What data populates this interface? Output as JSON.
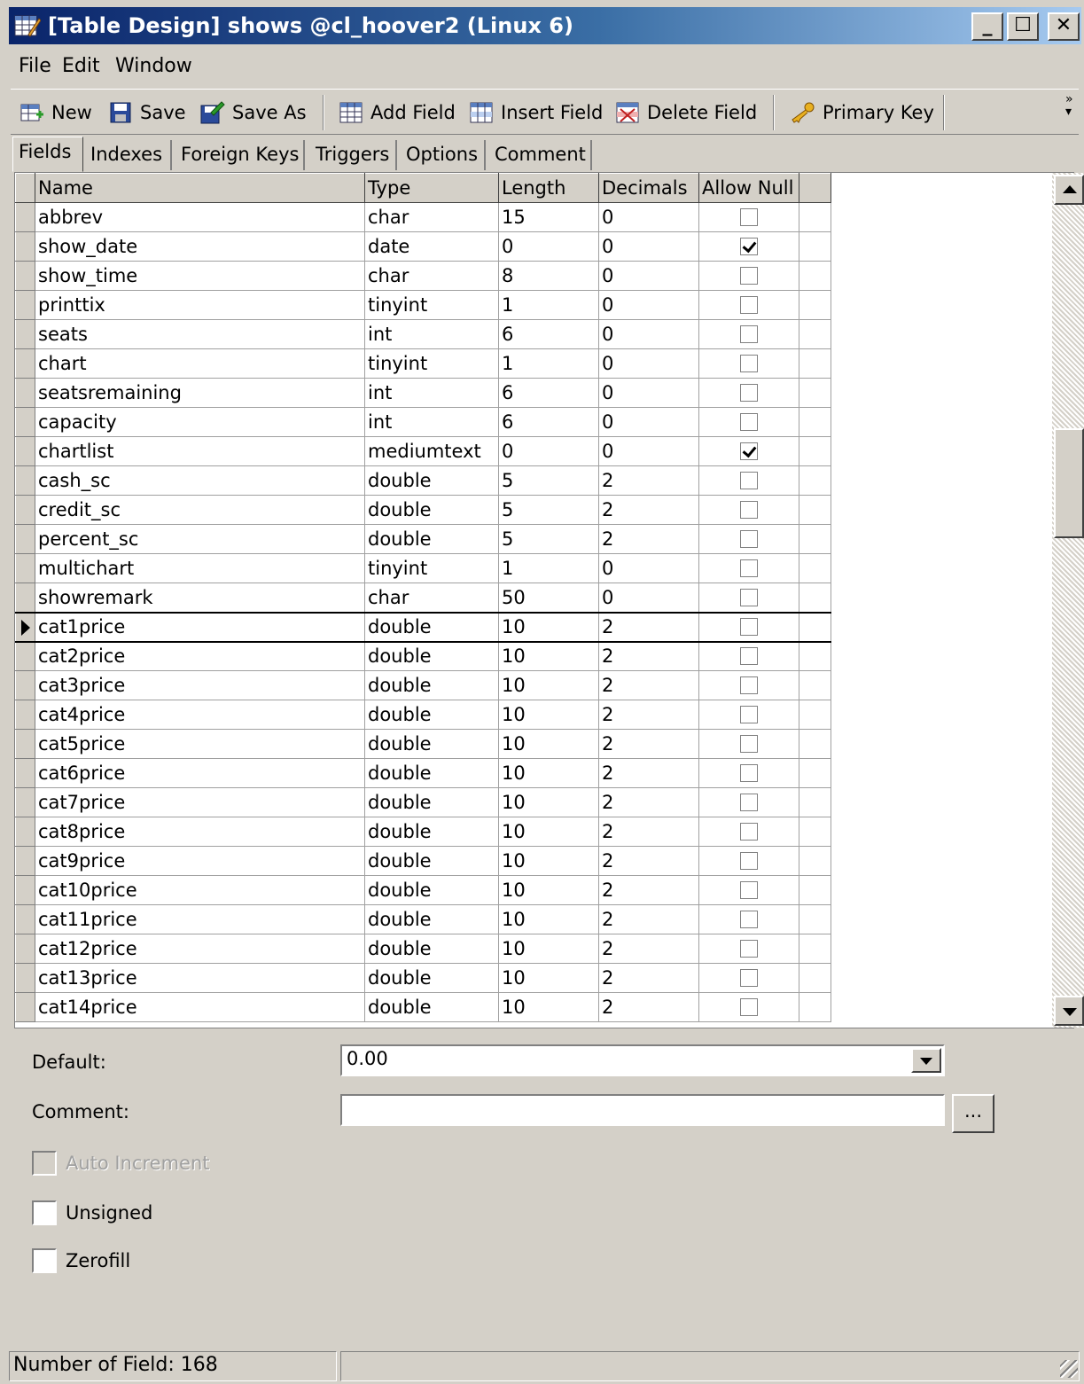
{
  "window": {
    "title": "[Table Design] shows @cl_hoover2 (Linux 6)",
    "controls": {
      "minimize": "_",
      "maximize": "☐",
      "close": "✕"
    }
  },
  "menu": {
    "file": "File",
    "edit": "Edit",
    "window": "Window"
  },
  "toolbar": {
    "new": "New",
    "save": "Save",
    "save_as": "Save As",
    "add_field": "Add Field",
    "insert_field": "Insert Field",
    "delete_field": "Delete Field",
    "primary_key": "Primary Key",
    "overflow": "»"
  },
  "tabs": [
    "Fields",
    "Indexes",
    "Foreign Keys",
    "Triggers",
    "Options",
    "Comment"
  ],
  "grid": {
    "columns": [
      "Name",
      "Type",
      "Length",
      "Decimals",
      "Allow Null"
    ],
    "selected_row": 14,
    "rows": [
      {
        "name": "abbrev",
        "type": "char",
        "length": "15",
        "decimals": "0",
        "allow_null": false
      },
      {
        "name": "show_date",
        "type": "date",
        "length": "0",
        "decimals": "0",
        "allow_null": true
      },
      {
        "name": "show_time",
        "type": "char",
        "length": "8",
        "decimals": "0",
        "allow_null": false
      },
      {
        "name": "printtix",
        "type": "tinyint",
        "length": "1",
        "decimals": "0",
        "allow_null": false
      },
      {
        "name": "seats",
        "type": "int",
        "length": "6",
        "decimals": "0",
        "allow_null": false
      },
      {
        "name": "chart",
        "type": "tinyint",
        "length": "1",
        "decimals": "0",
        "allow_null": false
      },
      {
        "name": "seatsremaining",
        "type": "int",
        "length": "6",
        "decimals": "0",
        "allow_null": false
      },
      {
        "name": "capacity",
        "type": "int",
        "length": "6",
        "decimals": "0",
        "allow_null": false
      },
      {
        "name": "chartlist",
        "type": "mediumtext",
        "length": "0",
        "decimals": "0",
        "allow_null": true
      },
      {
        "name": "cash_sc",
        "type": "double",
        "length": "5",
        "decimals": "2",
        "allow_null": false
      },
      {
        "name": "credit_sc",
        "type": "double",
        "length": "5",
        "decimals": "2",
        "allow_null": false
      },
      {
        "name": "percent_sc",
        "type": "double",
        "length": "5",
        "decimals": "2",
        "allow_null": false
      },
      {
        "name": "multichart",
        "type": "tinyint",
        "length": "1",
        "decimals": "0",
        "allow_null": false
      },
      {
        "name": "showremark",
        "type": "char",
        "length": "50",
        "decimals": "0",
        "allow_null": false
      },
      {
        "name": "cat1price",
        "type": "double",
        "length": "10",
        "decimals": "2",
        "allow_null": false
      },
      {
        "name": "cat2price",
        "type": "double",
        "length": "10",
        "decimals": "2",
        "allow_null": false
      },
      {
        "name": "cat3price",
        "type": "double",
        "length": "10",
        "decimals": "2",
        "allow_null": false
      },
      {
        "name": "cat4price",
        "type": "double",
        "length": "10",
        "decimals": "2",
        "allow_null": false
      },
      {
        "name": "cat5price",
        "type": "double",
        "length": "10",
        "decimals": "2",
        "allow_null": false
      },
      {
        "name": "cat6price",
        "type": "double",
        "length": "10",
        "decimals": "2",
        "allow_null": false
      },
      {
        "name": "cat7price",
        "type": "double",
        "length": "10",
        "decimals": "2",
        "allow_null": false
      },
      {
        "name": "cat8price",
        "type": "double",
        "length": "10",
        "decimals": "2",
        "allow_null": false
      },
      {
        "name": "cat9price",
        "type": "double",
        "length": "10",
        "decimals": "2",
        "allow_null": false
      },
      {
        "name": "cat10price",
        "type": "double",
        "length": "10",
        "decimals": "2",
        "allow_null": false
      },
      {
        "name": "cat11price",
        "type": "double",
        "length": "10",
        "decimals": "2",
        "allow_null": false
      },
      {
        "name": "cat12price",
        "type": "double",
        "length": "10",
        "decimals": "2",
        "allow_null": false
      },
      {
        "name": "cat13price",
        "type": "double",
        "length": "10",
        "decimals": "2",
        "allow_null": false
      },
      {
        "name": "cat14price",
        "type": "double",
        "length": "10",
        "decimals": "2",
        "allow_null": false
      }
    ]
  },
  "properties": {
    "default_label": "Default:",
    "default_value": "0.00",
    "comment_label": "Comment:",
    "comment_value": "",
    "ellipsis": "...",
    "auto_increment": "Auto Increment",
    "unsigned": "Unsigned",
    "zerofill": "Zerofill"
  },
  "status": {
    "field_count": "Number of Field: 168"
  },
  "colors": {
    "title_start": "#0a246a",
    "title_end": "#a6caf0",
    "face": "#d4d0c8"
  }
}
